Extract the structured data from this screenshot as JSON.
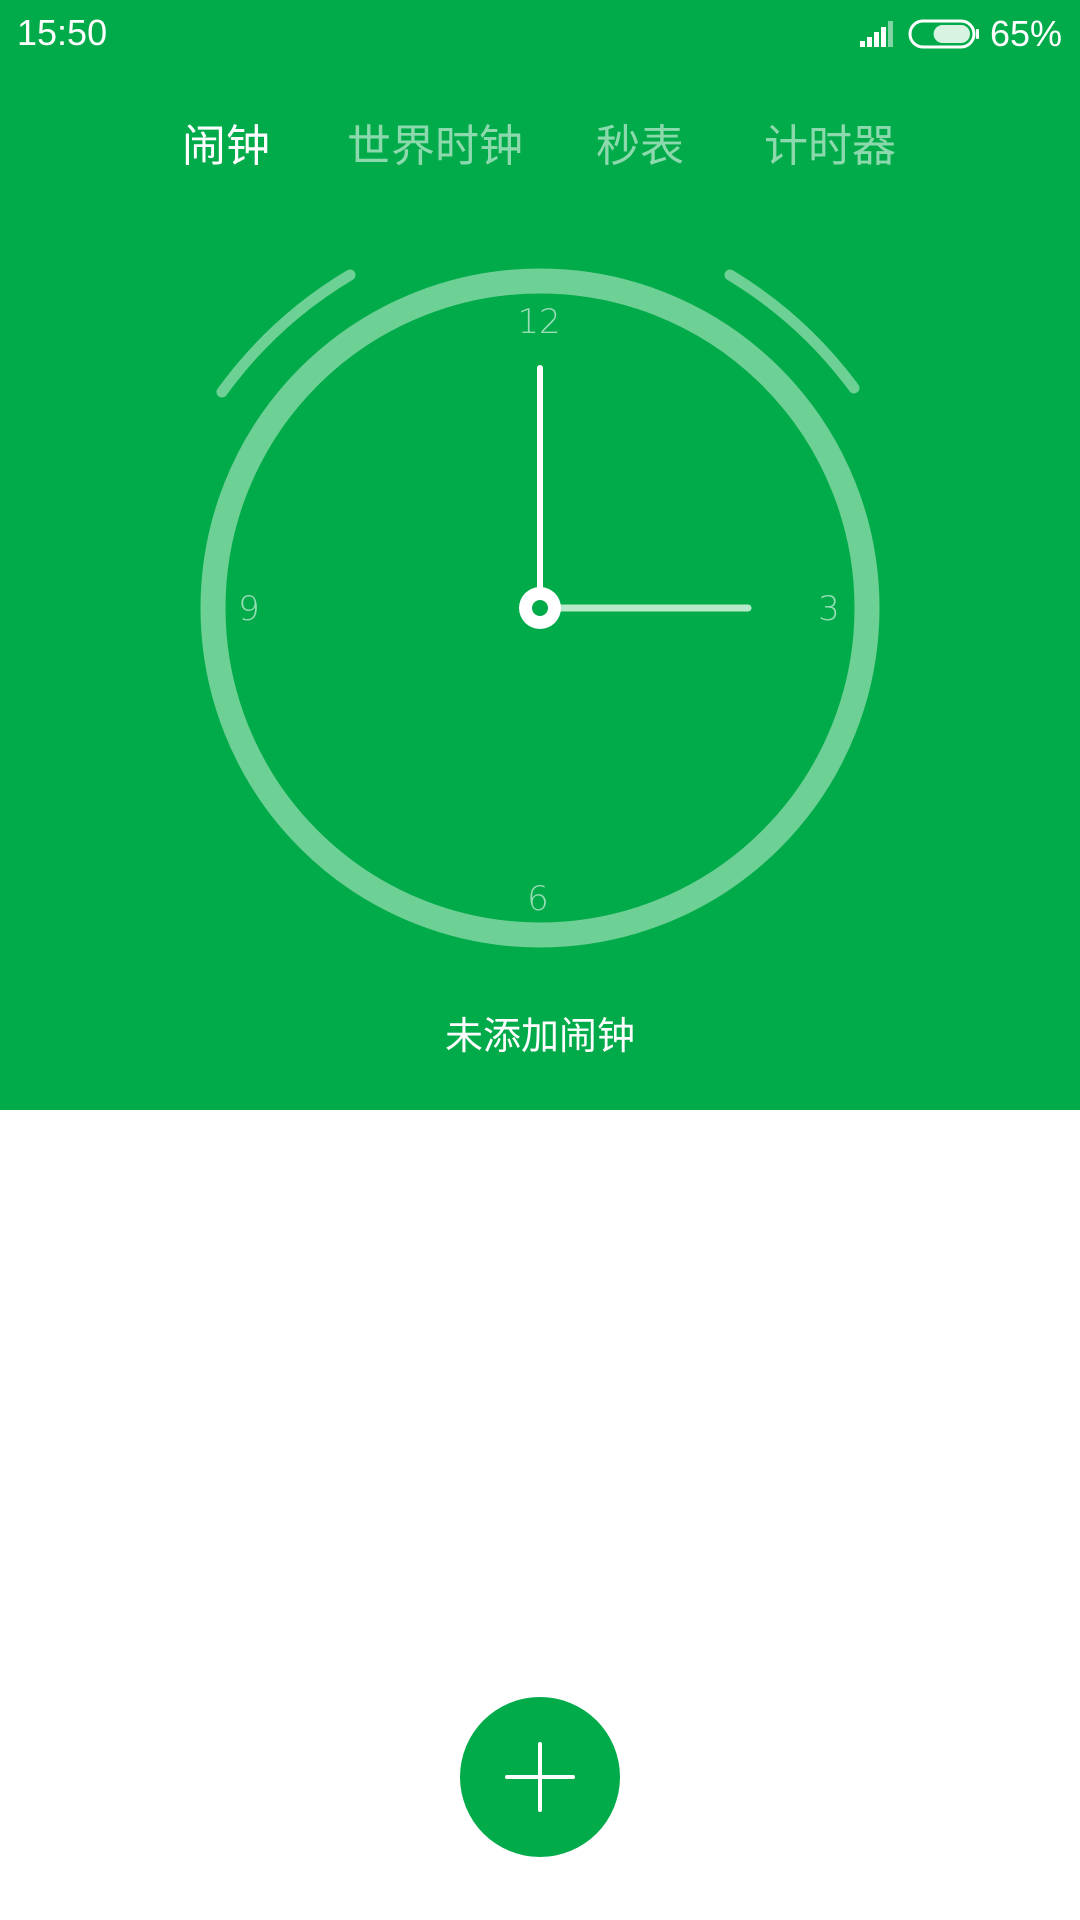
{
  "status_bar": {
    "time": "15:50",
    "battery_percent_text": "65%",
    "battery_level": 0.65,
    "signal_icon": "signal-bars-icon",
    "battery_icon": "battery-icon"
  },
  "tabs": [
    {
      "label": "闹钟",
      "active": true
    },
    {
      "label": "世界时钟",
      "active": false
    },
    {
      "label": "秒表",
      "active": false
    },
    {
      "label": "计时器",
      "active": false
    }
  ],
  "clock": {
    "numbers": {
      "top": "12",
      "right": "3",
      "bottom": "6",
      "left": "9"
    },
    "hour": 3,
    "minute": 0
  },
  "empty_message": "未添加闹钟",
  "fab": {
    "icon": "plus-icon"
  },
  "colors": {
    "primary": "#02ab49",
    "ring": "#6dd095",
    "white": "#ffffff"
  }
}
